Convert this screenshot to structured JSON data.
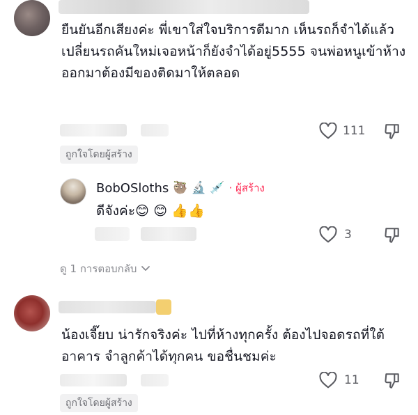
{
  "comment1": {
    "text": "ยืนยันอีกเสียงค่ะ พี่เขาใส่ใจบริการดีมาก เห็นรถก็จำได้แล้ว เปลี่ยนรถคันใหม่เจอหน้าก็ยังจำได้อยู่5555 จนพ่อหนูเข้าห้างออกมาต้องมีของติดมาให้ตลอด",
    "like_count": "111",
    "liked_by_creator": "ถูกใจโดยผู้สร้าง"
  },
  "reply1": {
    "username": "BobOSloths",
    "badge_emojis": "🦥 🔬 💉",
    "creator_label": "· ผู้สร้าง",
    "text": "ดีจังค่ะ😊 😊 👍👍",
    "like_count": "3"
  },
  "view_replies": {
    "label": "ดู 1 การตอบกลับ",
    "chevron": "chevron-down-icon"
  },
  "comment2": {
    "text": "น้องเจี๊ยบ น่ารักจริงค่ะ ไปที่ห้างทุกครั้ง ต้องไปจอดรถที่ใต้อาคาร จำลูกค้าได้ทุกคน ขอชื่นชมค่ะ",
    "like_count": "11",
    "liked_by_creator": "ถูกใจโดยผู้สร้าง"
  },
  "colors": {
    "creator_red": "#fe2c55",
    "text_primary": "#161823",
    "text_secondary": "#8a8b91"
  }
}
